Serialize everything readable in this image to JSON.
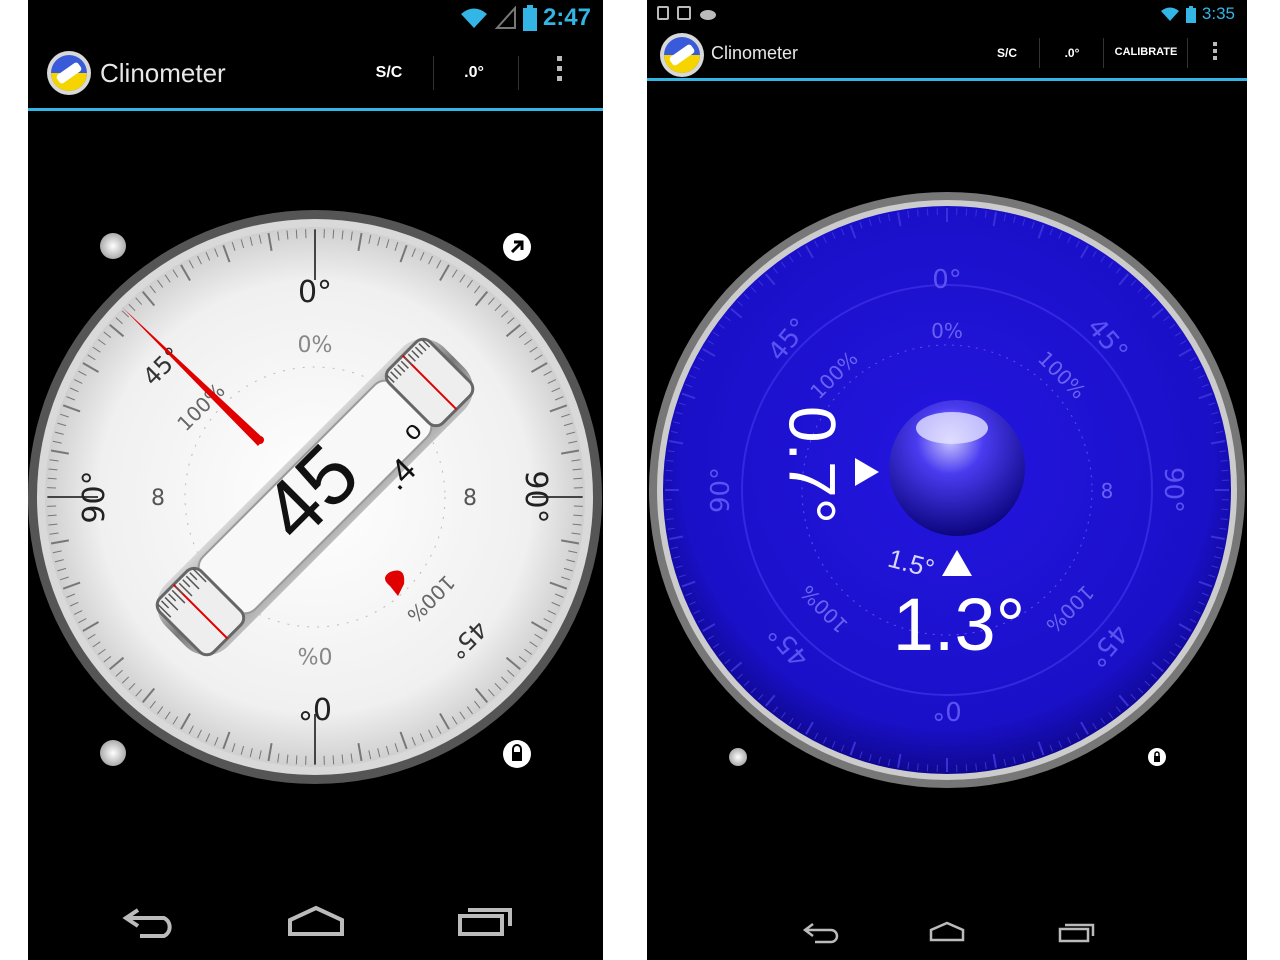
{
  "left": {
    "status": {
      "time": "2:47"
    },
    "actionbar": {
      "title": "Clinometer",
      "sc_label": "S/C",
      "precision_label": ".0°"
    },
    "dial": {
      "ticks_text": {
        "zero_top": "0°",
        "zero_pct_top": "0%",
        "forty_five_top": "45°",
        "hundred_pct_top": "100%",
        "ninety_left": "90°",
        "ninety_right": "90°",
        "inf_left": "8",
        "inf_right": "8",
        "zero_bottom": "0°",
        "zero_pct_bottom": "0%",
        "forty_five_bottom": "45°",
        "hundred_pct_bottom": "100%"
      },
      "reading_main": "45",
      "reading_decimal": ".4",
      "reading_degree": "o"
    },
    "colors": {
      "accent": "#33b5e5",
      "needle": "#e00000",
      "dial_face": "#f2f2f2"
    }
  },
  "right": {
    "status": {
      "time": "3:35"
    },
    "actionbar": {
      "title": "Clinometer",
      "sc_label": "S/C",
      "precision_label": ".0°",
      "calibrate_label": "CALIBRATE"
    },
    "dial": {
      "labels": {
        "zero_top": "0°",
        "zero_pct_top": "0%",
        "forty_five_tl": "45°",
        "forty_five_tr": "45°",
        "hundred_pct_tl": "100%",
        "hundred_pct_tr": "100%",
        "ninety_left": "90°",
        "ninety_right": "90°",
        "inf_right": "8",
        "zero_bottom": "0°",
        "forty_five_bl": "45°",
        "forty_five_br": "45°",
        "hundred_pct_bl": "100%",
        "hundred_pct_br": "100%"
      },
      "reading_vertical": "0.7°",
      "reading_small": "1.5°",
      "reading_main": "1.3°"
    },
    "colors": {
      "accent": "#33b5e5",
      "dial_face": "#1a0fd0",
      "text": "#ffffff"
    }
  }
}
